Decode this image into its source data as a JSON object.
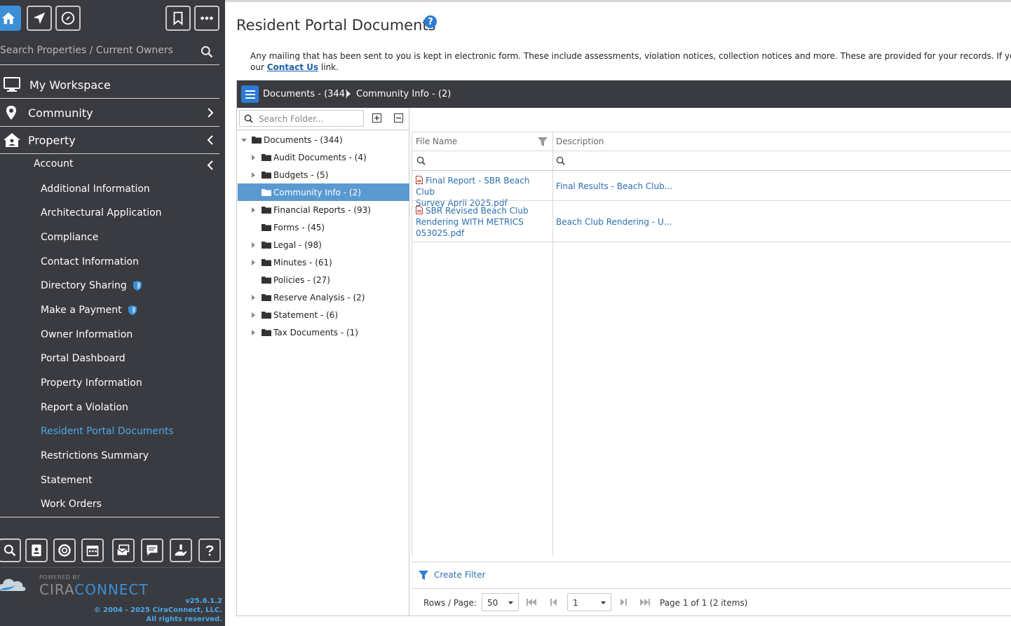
{
  "sidebar": {
    "search_placeholder": "Search Properties / Current Owners",
    "nav": {
      "workspace": "My Workspace",
      "community": "Community",
      "property": "Property",
      "account": "Account"
    },
    "items": [
      {
        "label": "Additional Information"
      },
      {
        "label": "Architectural Application"
      },
      {
        "label": "Compliance"
      },
      {
        "label": "Contact Information"
      },
      {
        "label": "Directory Sharing"
      },
      {
        "label": "Make a Payment"
      },
      {
        "label": "Owner Information"
      },
      {
        "label": "Portal Dashboard"
      },
      {
        "label": "Property Information"
      },
      {
        "label": "Report a Violation"
      },
      {
        "label": "Resident Portal Documents"
      },
      {
        "label": "Restrictions Summary"
      },
      {
        "label": "Statement"
      },
      {
        "label": "Work Orders"
      }
    ],
    "powered_by": "POWERED BY",
    "brand_a": "CIRA",
    "brand_b": "CONNECT",
    "version": "v25.6.1.2",
    "copyright": "© 2004 - 2025 CiraConnect, LLC.",
    "rights": "All rights reserved.",
    "accent": "#3a8fd6"
  },
  "page": {
    "title": "Resident Portal Documents",
    "help_glyph": "?",
    "desc_line1": "Any mailing that has been sent to you is kept in electronic form. These include assessments, violation notices, collection notices and more. These are provided for your records. If you have questions regard",
    "desc_line2_pre": "our ",
    "desc_link": "Contact Us",
    "desc_line2_post": " link."
  },
  "breadcrumb": {
    "root": "Documents - (344)",
    "current": "Community Info - (2)"
  },
  "tree": {
    "search_placeholder": "Search Folder...",
    "root": "Documents - (344)",
    "folders": [
      {
        "label": "Audit Documents - (4)",
        "expandable": true
      },
      {
        "label": "Budgets - (5)",
        "expandable": true
      },
      {
        "label": "Community Info - (2)",
        "expandable": false,
        "selected": true
      },
      {
        "label": "Financial Reports - (93)",
        "expandable": true
      },
      {
        "label": "Forms - (45)",
        "expandable": false
      },
      {
        "label": "Legal - (98)",
        "expandable": true
      },
      {
        "label": "Minutes - (61)",
        "expandable": true
      },
      {
        "label": "Policies - (27)",
        "expandable": false
      },
      {
        "label": "Reserve Analysis - (2)",
        "expandable": true
      },
      {
        "label": "Statement - (6)",
        "expandable": true
      },
      {
        "label": "Tax Documents - (1)",
        "expandable": true
      }
    ]
  },
  "grid": {
    "col_file": "File Name",
    "col_desc": "Description",
    "rows": [
      {
        "file_a": "Final Report - SBR Beach Club",
        "file_b": "Survey April 2025.pdf",
        "desc": "Final Results - Beach Club..."
      },
      {
        "file_a": "SBR Revised Beach Club",
        "file_b": "Rendering WITH METRICS",
        "file_c": "053025.pdf",
        "desc": "Beach Club Rendering - U..."
      }
    ],
    "create_filter": "Create Filter",
    "rows_per_page_label": "Rows / Page:",
    "rows_per_page": "50",
    "page_select": "1",
    "page_info": "Page 1 of 1 (2 items)"
  }
}
